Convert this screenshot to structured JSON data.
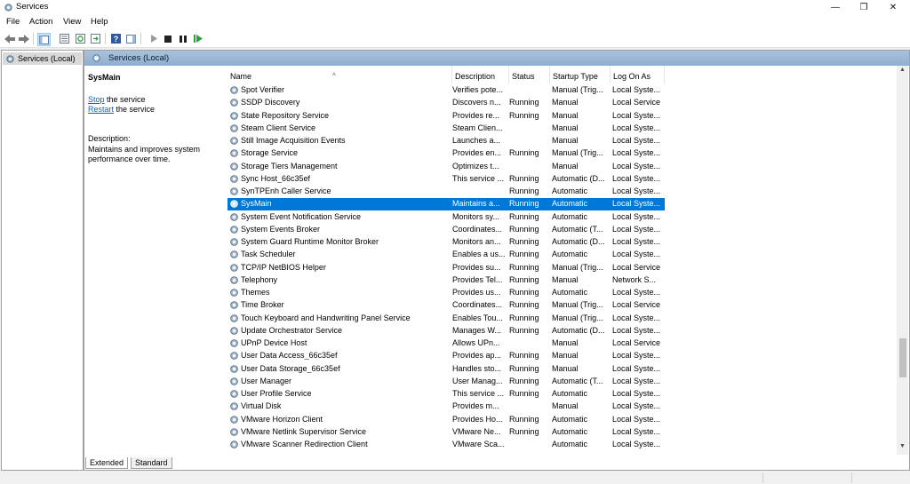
{
  "window": {
    "title": "Services",
    "icon": "services-gear-icon"
  },
  "menubar": {
    "items": [
      "File",
      "Action",
      "View",
      "Help"
    ]
  },
  "toolbar": {
    "icons": [
      "back-icon",
      "forward-icon",
      "show-console-tree-icon",
      "properties-icon",
      "refresh-icon",
      "export-list-icon",
      "help-icon",
      "show-action-pane-icon",
      "start-service-icon",
      "stop-service-icon",
      "pause-service-icon",
      "restart-service-icon"
    ]
  },
  "tree": {
    "root_label": "Services (Local)"
  },
  "header": {
    "title": "Services (Local)"
  },
  "detail": {
    "service_name": "SysMain",
    "stop_link": "Stop",
    "stop_suffix": " the service",
    "restart_link": "Restart",
    "restart_suffix": " the service",
    "description_label": "Description:",
    "description_line1": "Maintains and improves system",
    "description_line2": "performance over time."
  },
  "columns": [
    "Name",
    "Description",
    "Status",
    "Startup Type",
    "Log On As"
  ],
  "rows": [
    {
      "name": "Spot Verifier",
      "desc": "Verifies pote...",
      "status": "",
      "startup": "Manual (Trig...",
      "logon": "Local Syste..."
    },
    {
      "name": "SSDP Discovery",
      "desc": "Discovers n...",
      "status": "Running",
      "startup": "Manual",
      "logon": "Local Service"
    },
    {
      "name": "State Repository Service",
      "desc": "Provides re...",
      "status": "Running",
      "startup": "Manual",
      "logon": "Local Syste..."
    },
    {
      "name": "Steam Client Service",
      "desc": "Steam Clien...",
      "status": "",
      "startup": "Manual",
      "logon": "Local Syste..."
    },
    {
      "name": "Still Image Acquisition Events",
      "desc": "Launches a...",
      "status": "",
      "startup": "Manual",
      "logon": "Local Syste..."
    },
    {
      "name": "Storage Service",
      "desc": "Provides en...",
      "status": "Running",
      "startup": "Manual (Trig...",
      "logon": "Local Syste..."
    },
    {
      "name": "Storage Tiers Management",
      "desc": "Optimizes t...",
      "status": "",
      "startup": "Manual",
      "logon": "Local Syste..."
    },
    {
      "name": "Sync Host_66c35ef",
      "desc": "This service ...",
      "status": "Running",
      "startup": "Automatic (D...",
      "logon": "Local Syste..."
    },
    {
      "name": "SynTPEnh Caller Service",
      "desc": "",
      "status": "Running",
      "startup": "Automatic",
      "logon": "Local Syste..."
    },
    {
      "name": "SysMain",
      "desc": "Maintains a...",
      "status": "Running",
      "startup": "Automatic",
      "logon": "Local Syste...",
      "selected": true
    },
    {
      "name": "System Event Notification Service",
      "desc": "Monitors sy...",
      "status": "Running",
      "startup": "Automatic",
      "logon": "Local Syste..."
    },
    {
      "name": "System Events Broker",
      "desc": "Coordinates...",
      "status": "Running",
      "startup": "Automatic (T...",
      "logon": "Local Syste..."
    },
    {
      "name": "System Guard Runtime Monitor Broker",
      "desc": "Monitors an...",
      "status": "Running",
      "startup": "Automatic (D...",
      "logon": "Local Syste..."
    },
    {
      "name": "Task Scheduler",
      "desc": "Enables a us...",
      "status": "Running",
      "startup": "Automatic",
      "logon": "Local Syste..."
    },
    {
      "name": "TCP/IP NetBIOS Helper",
      "desc": "Provides su...",
      "status": "Running",
      "startup": "Manual (Trig...",
      "logon": "Local Service"
    },
    {
      "name": "Telephony",
      "desc": "Provides Tel...",
      "status": "Running",
      "startup": "Manual",
      "logon": "Network S..."
    },
    {
      "name": "Themes",
      "desc": "Provides us...",
      "status": "Running",
      "startup": "Automatic",
      "logon": "Local Syste..."
    },
    {
      "name": "Time Broker",
      "desc": "Coordinates...",
      "status": "Running",
      "startup": "Manual (Trig...",
      "logon": "Local Service"
    },
    {
      "name": "Touch Keyboard and Handwriting Panel Service",
      "desc": "Enables Tou...",
      "status": "Running",
      "startup": "Manual (Trig...",
      "logon": "Local Syste..."
    },
    {
      "name": "Update Orchestrator Service",
      "desc": "Manages W...",
      "status": "Running",
      "startup": "Automatic (D...",
      "logon": "Local Syste..."
    },
    {
      "name": "UPnP Device Host",
      "desc": "Allows UPn...",
      "status": "",
      "startup": "Manual",
      "logon": "Local Service"
    },
    {
      "name": "User Data Access_66c35ef",
      "desc": "Provides ap...",
      "status": "Running",
      "startup": "Manual",
      "logon": "Local Syste..."
    },
    {
      "name": "User Data Storage_66c35ef",
      "desc": "Handles sto...",
      "status": "Running",
      "startup": "Manual",
      "logon": "Local Syste..."
    },
    {
      "name": "User Manager",
      "desc": "User Manag...",
      "status": "Running",
      "startup": "Automatic (T...",
      "logon": "Local Syste..."
    },
    {
      "name": "User Profile Service",
      "desc": "This service ...",
      "status": "Running",
      "startup": "Automatic",
      "logon": "Local Syste..."
    },
    {
      "name": "Virtual Disk",
      "desc": "Provides m...",
      "status": "",
      "startup": "Manual",
      "logon": "Local Syste..."
    },
    {
      "name": "VMware Horizon Client",
      "desc": "Provides Ho...",
      "status": "Running",
      "startup": "Automatic",
      "logon": "Local Syste..."
    },
    {
      "name": "VMware Netlink Supervisor Service",
      "desc": "VMware Ne...",
      "status": "Running",
      "startup": "Automatic",
      "logon": "Local Syste..."
    },
    {
      "name": "VMware Scanner Redirection Client",
      "desc": "VMware Sca...",
      "status": "",
      "startup": "Automatic",
      "logon": "Local Syste..."
    }
  ],
  "tabs": [
    "Extended",
    "Standard"
  ],
  "colors": {
    "selection": "#0078d7",
    "header_gradient_top": "#a9c2dc",
    "link": "#1a5fb4"
  }
}
